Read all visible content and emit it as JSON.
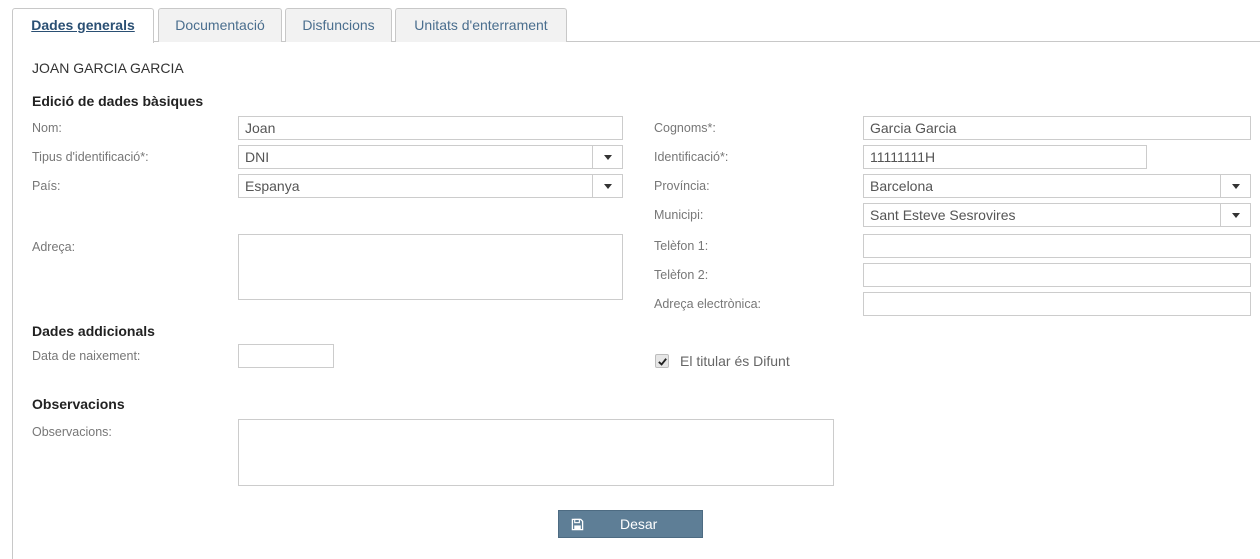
{
  "tabs": [
    {
      "label": "Dades generals",
      "active": true
    },
    {
      "label": "Documentació",
      "active": false
    },
    {
      "label": "Disfuncions",
      "active": false
    },
    {
      "label": "Unitats d'enterrament",
      "active": false
    }
  ],
  "person_name": "JOAN GARCIA GARCIA",
  "basic": {
    "title": "Edició de dades bàsiques",
    "nom_label": "Nom:",
    "nom_value": "Joan",
    "cognoms_label": "Cognoms*:",
    "cognoms_value": "Garcia Garcia",
    "tipus_label": "Tipus d'identificació*:",
    "tipus_value": "DNI",
    "identificacio_label": "Identificació*:",
    "identificacio_value": "11111111H",
    "pais_label": "País:",
    "pais_value": "Espanya",
    "provincia_label": "Província:",
    "provincia_value": "Barcelona",
    "municipi_label": "Municipi:",
    "municipi_value": "Sant Esteve Sesrovires",
    "adreca_label": "Adreça:",
    "telefon1_label": "Telèfon 1:",
    "telefon2_label": "Telèfon 2:",
    "email_label": "Adreça electrònica:"
  },
  "additional": {
    "title": "Dades addicionals",
    "naixement_label": "Data de naixement:",
    "difunt_label": "El titular és Difunt",
    "difunt_checked": true
  },
  "observations": {
    "title": "Observacions",
    "label": "Observacions:"
  },
  "save_button": {
    "label": "Desar",
    "icon": "floppy-disk-icon"
  }
}
